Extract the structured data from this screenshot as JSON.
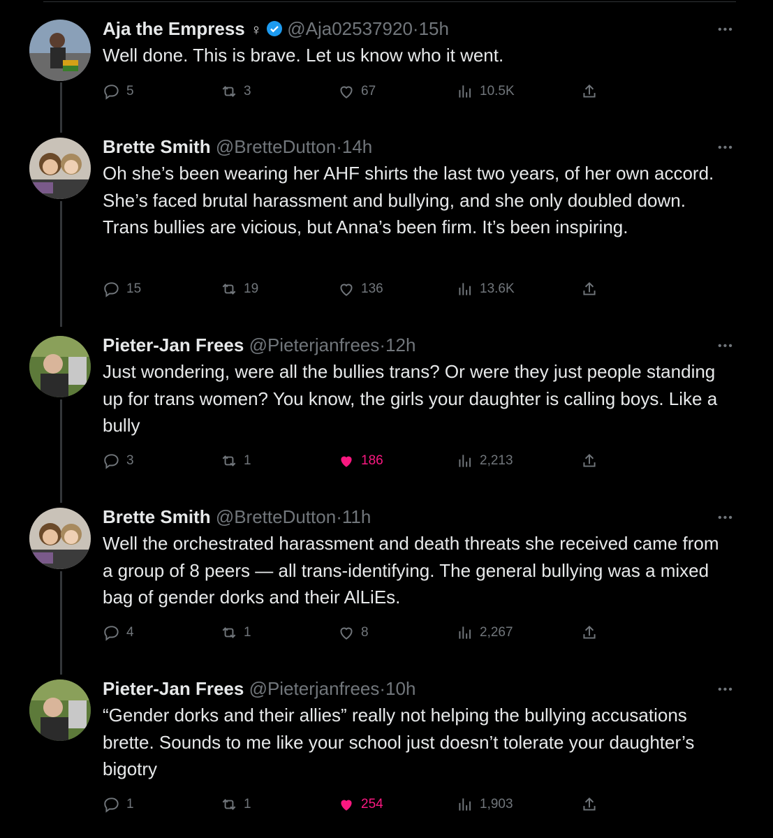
{
  "tweets": [
    {
      "name": "Aja the Empress",
      "gender_symbol": "♀",
      "handle": "@Aja02537920",
      "separator": "·",
      "time": "15h",
      "verified": true,
      "avatar_icon": "user-avatar-photo",
      "text": [
        "Well done. This is brave. Let us know who it went."
      ],
      "replies": "5",
      "retweets": "3",
      "likes": "67",
      "views": "10.5K",
      "liked": false
    },
    {
      "name": "Brette Smith",
      "handle": "@BretteDutton",
      "separator": "·",
      "time": "14h",
      "verified": false,
      "avatar_icon": "user-avatar-photo",
      "text": [
        "Oh she’s been wearing her AHF shirts the last two years, of her own accord. She’s faced brutal harassment and bullying, and she only doubled down.",
        "Trans bullies are vicious, but Anna’s been firm. It’s been inspiring."
      ],
      "replies": "15",
      "retweets": "19",
      "likes": "136",
      "views": "13.6K",
      "liked": false
    },
    {
      "name": "Pieter-Jan Frees",
      "handle": "@Pieterjanfrees",
      "separator": "·",
      "time": "12h",
      "verified": false,
      "avatar_icon": "user-avatar-photo",
      "text": [
        "Just wondering, were all the bullies trans? Or were they just people standing up for trans women? You know, the girls your daughter is calling boys. Like a bully"
      ],
      "replies": "3",
      "retweets": "1",
      "likes": "186",
      "views": "2,213",
      "liked": true
    },
    {
      "name": "Brette Smith",
      "handle": "@BretteDutton",
      "separator": "·",
      "time": "11h",
      "verified": false,
      "avatar_icon": "user-avatar-photo",
      "text": [
        "Well the orchestrated harassment and death threats she received came from a group of 8 peers — all trans-identifying. The general bullying was a mixed bag of gender dorks and their AlLiEs."
      ],
      "replies": "4",
      "retweets": "1",
      "likes": "8",
      "views": "2,267",
      "liked": false
    },
    {
      "name": "Pieter-Jan Frees",
      "handle": "@Pieterjanfrees",
      "separator": "·",
      "time": "10h",
      "verified": false,
      "avatar_icon": "user-avatar-photo",
      "text": [
        "“Gender dorks and their allies” really not helping the bullying accusations brette. Sounds to me like your school just doesn’t tolerate your daughter’s bigotry"
      ],
      "replies": "1",
      "retweets": "1",
      "likes": "254",
      "views": "1,903",
      "liked": true
    }
  ],
  "more_label": "•••",
  "colors": {
    "background": "#000000",
    "text": "#e7e9ea",
    "muted": "#71767b",
    "like": "#f91880",
    "verified": "#1d9bf0"
  }
}
